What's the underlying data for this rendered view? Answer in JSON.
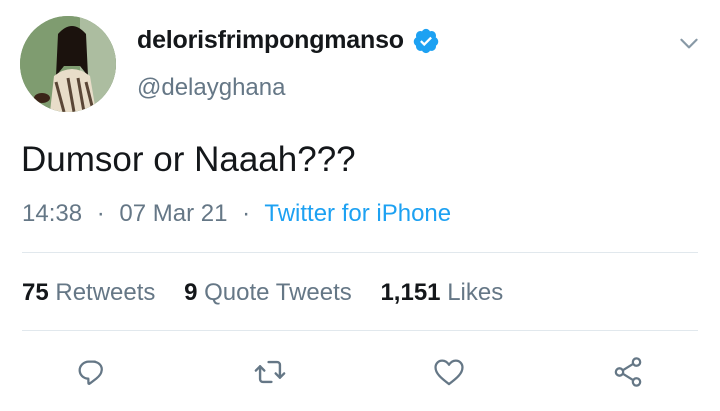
{
  "user": {
    "display_name": "delorisfrimpongmanso",
    "handle": "@delayghana",
    "verified": true
  },
  "tweet": {
    "text": "Dumsor or Naaah???",
    "time": "14:38",
    "date": "07 Mar 21",
    "separator": "·",
    "source": "Twitter for iPhone"
  },
  "stats": {
    "retweets_count": "75",
    "retweets_label": "Retweets",
    "quote_count": "9",
    "quote_label": "Quote Tweets",
    "likes_count": "1,151",
    "likes_label": "Likes"
  },
  "actions": {
    "reply_icon": "reply-icon",
    "retweet_icon": "retweet-icon",
    "like_icon": "heart-icon",
    "share_icon": "share-icon"
  },
  "colors": {
    "accent": "#1da1f2",
    "muted": "#657786",
    "text": "#14171a",
    "divider": "#e1e8ed"
  }
}
